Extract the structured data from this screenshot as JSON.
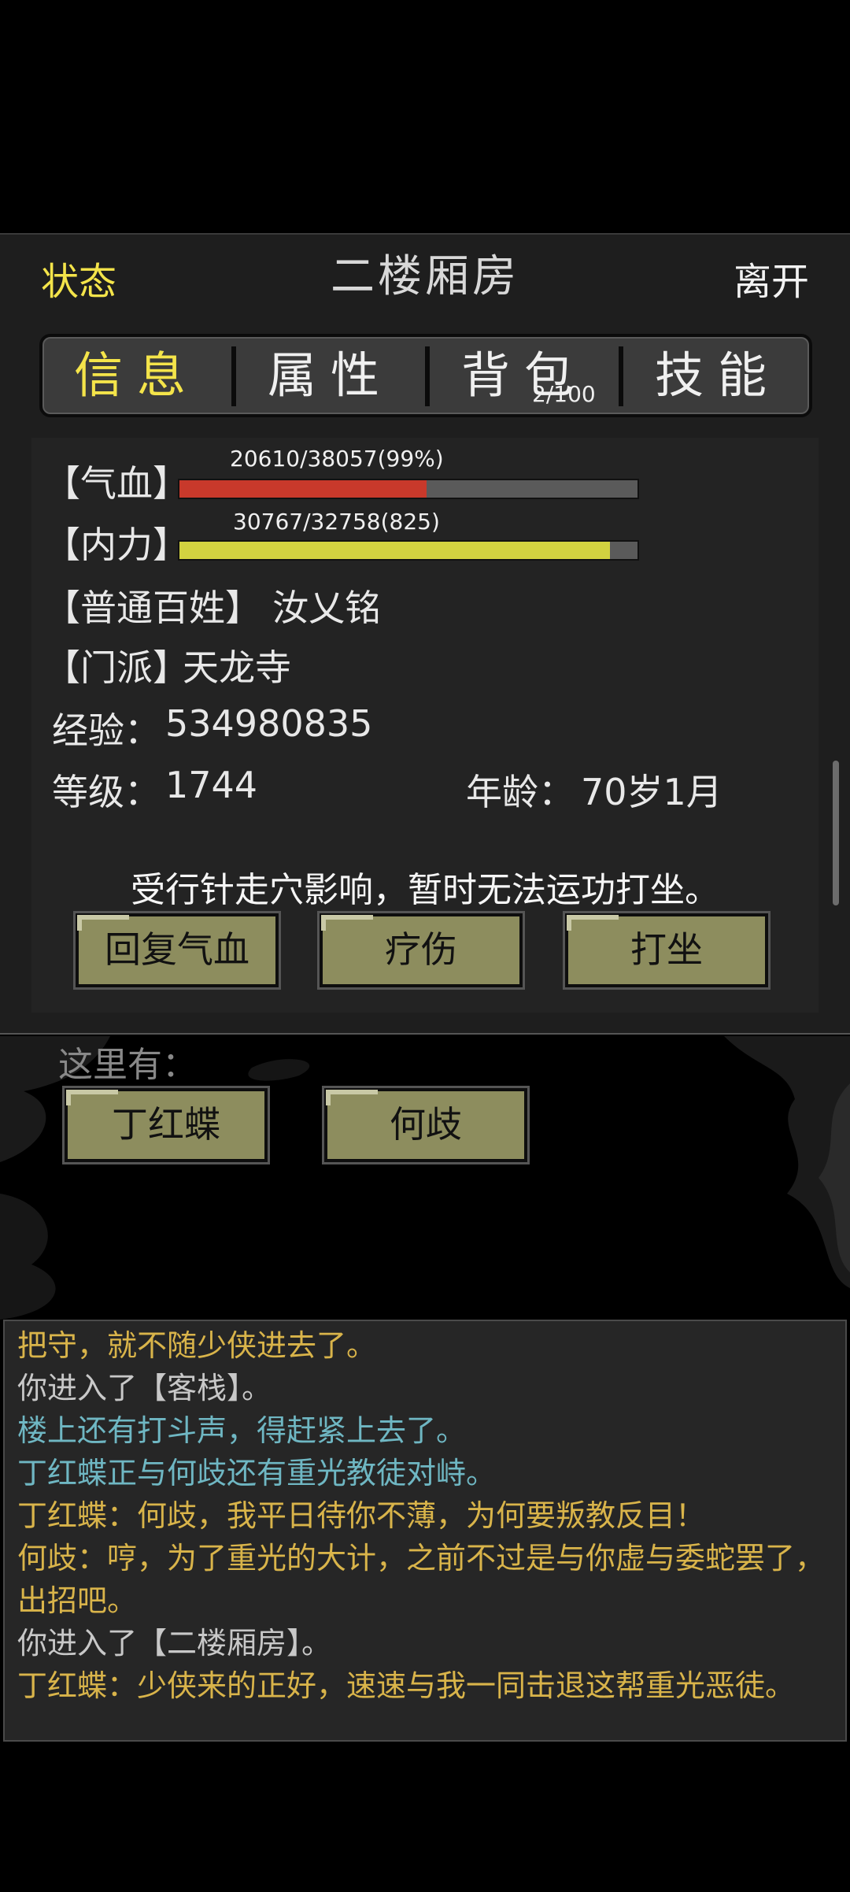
{
  "header": {
    "status": "状态",
    "title": "二楼厢房",
    "leave": "离开"
  },
  "tabs": [
    {
      "label": "信息"
    },
    {
      "label": "属性"
    },
    {
      "label": "背包",
      "sub": "2/100"
    },
    {
      "label": "技能"
    }
  ],
  "vitals": {
    "hp": {
      "label": "【气血】",
      "text": "20610/38057(99%)",
      "fill": 0.54,
      "color": "#c8392b"
    },
    "mp": {
      "label": "【内力】",
      "text": "30767/32758(825)",
      "fill": 0.94,
      "color": "#d2d240"
    }
  },
  "profile": {
    "rank": "【普通百姓】",
    "name": "汝乂铭",
    "sect_label": "【门派】",
    "sect": "天龙寺",
    "exp_label": "经验：",
    "exp": "534980835",
    "level_label": "等级：",
    "level": "1744",
    "age_label": "年龄：",
    "age": "70岁1月"
  },
  "warning": "受行针走穴影响，暂时无法运功打坐。",
  "actions": {
    "heal_hp": "回复气血",
    "treat": "疗伤",
    "meditate": "打坐"
  },
  "scene": {
    "caption": "这里有：",
    "npcs": [
      "丁红蝶",
      "何歧"
    ]
  },
  "log": [
    {
      "text": "把守，就不随少侠进去了。",
      "color": "gold"
    },
    {
      "text": "你进入了【客栈】。",
      "color": "grey"
    },
    {
      "text": "楼上还有打斗声，得赶紧上去了。",
      "color": "teal"
    },
    {
      "text": "丁红蝶正与何歧还有重光教徒对峙。",
      "color": "teal"
    },
    {
      "text": "丁红蝶：何歧，我平日待你不薄，为何要叛教反目！",
      "color": "gold"
    },
    {
      "text": "何歧：哼，为了重光的大计，之前不过是与你虚与委蛇罢了，出招吧。",
      "color": "gold"
    },
    {
      "text": "你进入了【二楼厢房】。",
      "color": "grey"
    },
    {
      "text": "丁红蝶：少侠来的正好，速速与我一同击退这帮重光恶徒。",
      "color": "gold"
    }
  ]
}
